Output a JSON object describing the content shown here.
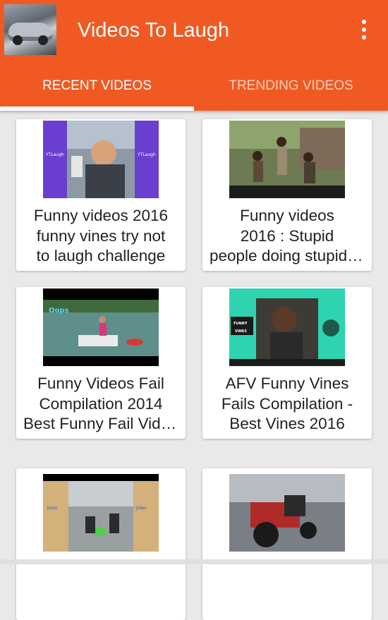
{
  "app": {
    "title": "Videos To Laugh",
    "icon": "car-garage-photo",
    "accent_color": "#f05a22"
  },
  "tabs": [
    {
      "label": "RECENT VIDEOS",
      "selected": true
    },
    {
      "label": "TRENDING VIDEOS",
      "selected": false
    }
  ],
  "videos": [
    {
      "title_lines": [
        "Funny videos 2016",
        "funny vines try not",
        "to laugh challenge"
      ],
      "thumbnail_text": [
        "YTLaugh",
        "YTLaugh"
      ]
    },
    {
      "title_lines": [
        "Funny videos",
        "2016 : Stupid",
        "people doing stupid things"
      ],
      "thumbnail_text": []
    },
    {
      "title_lines": [
        "Funny Videos Fail",
        "Compilation 2014",
        "Best Funny Fail Videos"
      ],
      "thumbnail_text": [
        "Oops"
      ]
    },
    {
      "title_lines": [
        "AFV Funny Vines",
        "Fails Compilation -",
        "Best Vines 2016"
      ],
      "thumbnail_text": [
        "FUNNY",
        "VINES"
      ]
    },
    {
      "title_lines": [],
      "thumbnail_text": [
        "Joker",
        "Joker"
      ]
    },
    {
      "title_lines": [],
      "thumbnail_text": []
    }
  ]
}
